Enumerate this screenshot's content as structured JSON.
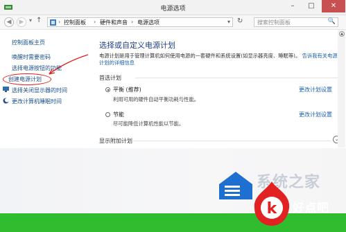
{
  "window": {
    "title": "电源选项",
    "min": "–",
    "max": "□",
    "close": "✕"
  },
  "nav": {
    "back": "◀",
    "forward": "▶",
    "up": "↑",
    "breadcrumb": [
      "控制面板",
      "硬件和声音",
      "电源选项"
    ],
    "separator": "›",
    "dropdown": "▾",
    "refresh": "↻",
    "search_placeholder": "搜索控制面板",
    "search_icon": "🔍"
  },
  "sidebar": {
    "home": "控制面板主页",
    "links": [
      {
        "label": "唤醒时需要密码",
        "icon": ""
      },
      {
        "label": "选择电源按钮的功能",
        "icon": ""
      },
      {
        "label": "创建电源计划",
        "icon": ""
      },
      {
        "label": "选择关闭显示器的时间",
        "icon": "monitor-icon"
      },
      {
        "label": "更改计算机睡眠时间",
        "icon": "moon-icon"
      }
    ]
  },
  "main": {
    "heading": "选择或自定义电源计划",
    "description": "电源计划是用于管理计算机如何使用电源的一套硬件和系统设置(如显示器亮度、睡眠等)。",
    "description_link": "告诉我有关电源计划的详细信息",
    "section_label": "首选计划",
    "plans": [
      {
        "name": "平衡 (推荐)",
        "desc": "利用可用的硬件自动平衡功耗与性能。",
        "link": "更改计划设置",
        "selected": true
      },
      {
        "name": "节能",
        "desc": "尽可能降低计算机性能以节能。",
        "link": "更改计划设置",
        "selected": false
      }
    ],
    "more_label": "显示附加计划",
    "expand": "⌄"
  },
  "watermark": {
    "text": "系统之家",
    "logo_text": "好点吧",
    "logo_glyph": "k"
  },
  "colors": {
    "accent": "#1e3f86",
    "link": "#1a5fb0",
    "highlight": "#e02020",
    "band": "#2fbd2f"
  }
}
